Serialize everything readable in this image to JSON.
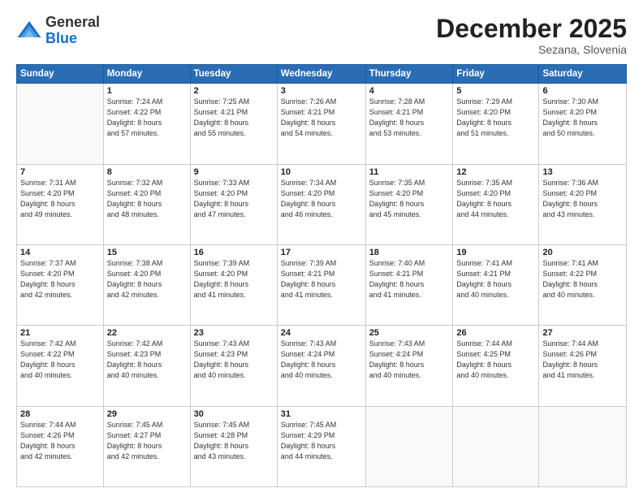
{
  "logo": {
    "general": "General",
    "blue": "Blue"
  },
  "header": {
    "month": "December 2025",
    "location": "Sezana, Slovenia"
  },
  "weekdays": [
    "Sunday",
    "Monday",
    "Tuesday",
    "Wednesday",
    "Thursday",
    "Friday",
    "Saturday"
  ],
  "weeks": [
    [
      {
        "day": "",
        "info": ""
      },
      {
        "day": "1",
        "info": "Sunrise: 7:24 AM\nSunset: 4:22 PM\nDaylight: 8 hours\nand 57 minutes."
      },
      {
        "day": "2",
        "info": "Sunrise: 7:25 AM\nSunset: 4:21 PM\nDaylight: 8 hours\nand 55 minutes."
      },
      {
        "day": "3",
        "info": "Sunrise: 7:26 AM\nSunset: 4:21 PM\nDaylight: 8 hours\nand 54 minutes."
      },
      {
        "day": "4",
        "info": "Sunrise: 7:28 AM\nSunset: 4:21 PM\nDaylight: 8 hours\nand 53 minutes."
      },
      {
        "day": "5",
        "info": "Sunrise: 7:29 AM\nSunset: 4:20 PM\nDaylight: 8 hours\nand 51 minutes."
      },
      {
        "day": "6",
        "info": "Sunrise: 7:30 AM\nSunset: 4:20 PM\nDaylight: 8 hours\nand 50 minutes."
      }
    ],
    [
      {
        "day": "7",
        "info": "Sunrise: 7:31 AM\nSunset: 4:20 PM\nDaylight: 8 hours\nand 49 minutes."
      },
      {
        "day": "8",
        "info": "Sunrise: 7:32 AM\nSunset: 4:20 PM\nDaylight: 8 hours\nand 48 minutes."
      },
      {
        "day": "9",
        "info": "Sunrise: 7:33 AM\nSunset: 4:20 PM\nDaylight: 8 hours\nand 47 minutes."
      },
      {
        "day": "10",
        "info": "Sunrise: 7:34 AM\nSunset: 4:20 PM\nDaylight: 8 hours\nand 46 minutes."
      },
      {
        "day": "11",
        "info": "Sunrise: 7:35 AM\nSunset: 4:20 PM\nDaylight: 8 hours\nand 45 minutes."
      },
      {
        "day": "12",
        "info": "Sunrise: 7:35 AM\nSunset: 4:20 PM\nDaylight: 8 hours\nand 44 minutes."
      },
      {
        "day": "13",
        "info": "Sunrise: 7:36 AM\nSunset: 4:20 PM\nDaylight: 8 hours\nand 43 minutes."
      }
    ],
    [
      {
        "day": "14",
        "info": "Sunrise: 7:37 AM\nSunset: 4:20 PM\nDaylight: 8 hours\nand 42 minutes."
      },
      {
        "day": "15",
        "info": "Sunrise: 7:38 AM\nSunset: 4:20 PM\nDaylight: 8 hours\nand 42 minutes."
      },
      {
        "day": "16",
        "info": "Sunrise: 7:39 AM\nSunset: 4:20 PM\nDaylight: 8 hours\nand 41 minutes."
      },
      {
        "day": "17",
        "info": "Sunrise: 7:39 AM\nSunset: 4:21 PM\nDaylight: 8 hours\nand 41 minutes."
      },
      {
        "day": "18",
        "info": "Sunrise: 7:40 AM\nSunset: 4:21 PM\nDaylight: 8 hours\nand 41 minutes."
      },
      {
        "day": "19",
        "info": "Sunrise: 7:41 AM\nSunset: 4:21 PM\nDaylight: 8 hours\nand 40 minutes."
      },
      {
        "day": "20",
        "info": "Sunrise: 7:41 AM\nSunset: 4:22 PM\nDaylight: 8 hours\nand 40 minutes."
      }
    ],
    [
      {
        "day": "21",
        "info": "Sunrise: 7:42 AM\nSunset: 4:22 PM\nDaylight: 8 hours\nand 40 minutes."
      },
      {
        "day": "22",
        "info": "Sunrise: 7:42 AM\nSunset: 4:23 PM\nDaylight: 8 hours\nand 40 minutes."
      },
      {
        "day": "23",
        "info": "Sunrise: 7:43 AM\nSunset: 4:23 PM\nDaylight: 8 hours\nand 40 minutes."
      },
      {
        "day": "24",
        "info": "Sunrise: 7:43 AM\nSunset: 4:24 PM\nDaylight: 8 hours\nand 40 minutes."
      },
      {
        "day": "25",
        "info": "Sunrise: 7:43 AM\nSunset: 4:24 PM\nDaylight: 8 hours\nand 40 minutes."
      },
      {
        "day": "26",
        "info": "Sunrise: 7:44 AM\nSunset: 4:25 PM\nDaylight: 8 hours\nand 40 minutes."
      },
      {
        "day": "27",
        "info": "Sunrise: 7:44 AM\nSunset: 4:26 PM\nDaylight: 8 hours\nand 41 minutes."
      }
    ],
    [
      {
        "day": "28",
        "info": "Sunrise: 7:44 AM\nSunset: 4:26 PM\nDaylight: 8 hours\nand 42 minutes."
      },
      {
        "day": "29",
        "info": "Sunrise: 7:45 AM\nSunset: 4:27 PM\nDaylight: 8 hours\nand 42 minutes."
      },
      {
        "day": "30",
        "info": "Sunrise: 7:45 AM\nSunset: 4:28 PM\nDaylight: 8 hours\nand 43 minutes."
      },
      {
        "day": "31",
        "info": "Sunrise: 7:45 AM\nSunset: 4:29 PM\nDaylight: 8 hours\nand 44 minutes."
      },
      {
        "day": "",
        "info": ""
      },
      {
        "day": "",
        "info": ""
      },
      {
        "day": "",
        "info": ""
      }
    ]
  ]
}
